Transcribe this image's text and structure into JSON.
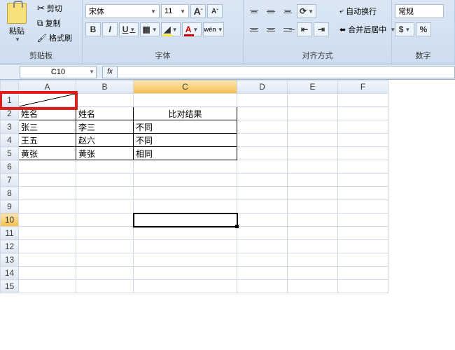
{
  "ribbon": {
    "clipboard": {
      "label": "剪贴板",
      "paste": "粘贴",
      "cut": "剪切",
      "copy": "复制",
      "format_painter": "格式刷"
    },
    "font": {
      "label": "字体",
      "name": "宋体",
      "size": "11",
      "increase": "A",
      "decrease": "A",
      "bold": "B",
      "italic": "I",
      "underline": "U",
      "phonetic": "wén"
    },
    "align": {
      "label": "对齐方式",
      "wrap": "自动换行",
      "merge": "合并后居中"
    },
    "number": {
      "label": "数字",
      "format": "常规",
      "percent": "%"
    }
  },
  "namebox": "C10",
  "fx_label": "fx",
  "columns": [
    "A",
    "B",
    "C",
    "D",
    "E",
    "F"
  ],
  "row_count": 15,
  "selected_cell": {
    "row": 10,
    "col": "C"
  },
  "highlight": {
    "row": 1,
    "col": "A"
  },
  "cells": {
    "A2": "姓名",
    "B2": "姓名",
    "C2": "比对结果",
    "A3": "张三",
    "B3": "李三",
    "C3": "不同",
    "A4": "王五",
    "B4": "赵六",
    "C4": "不同",
    "A5": "黄张",
    "B5": "黄张",
    "C5": "相同"
  }
}
